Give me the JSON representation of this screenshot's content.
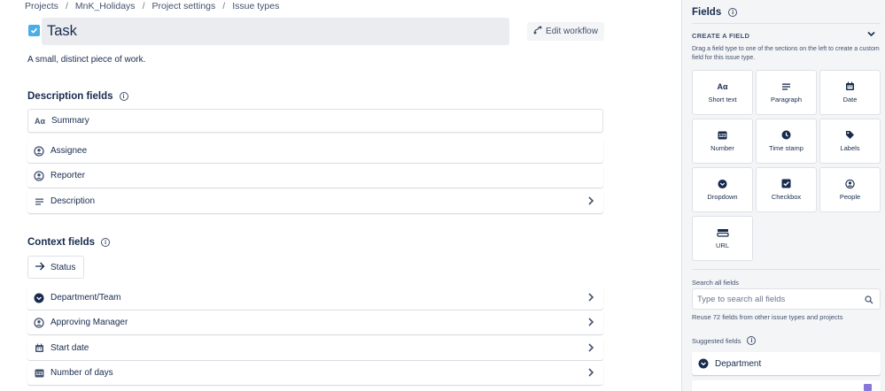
{
  "breadcrumbs": [
    "Projects",
    "MnK_Holidays",
    "Project settings",
    "Issue types"
  ],
  "issue_type": {
    "title": "Task",
    "description": "A small, distinct piece of work.",
    "edit_workflow_label": "Edit workflow"
  },
  "description_fields": {
    "title": "Description fields",
    "items": [
      {
        "label": "Summary",
        "icon": "text-icon"
      },
      {
        "label": "Assignee",
        "icon": "person-icon"
      },
      {
        "label": "Reporter",
        "icon": "person-icon"
      },
      {
        "label": "Description",
        "icon": "paragraph-icon"
      }
    ]
  },
  "context_fields": {
    "title": "Context fields",
    "status_label": "Status",
    "items": [
      {
        "label": "Department/Team",
        "icon": "dropdown-icon"
      },
      {
        "label": "Approving Manager",
        "icon": "person-icon"
      },
      {
        "label": "Start date",
        "icon": "calendar-icon"
      },
      {
        "label": "Number of days",
        "icon": "number-icon"
      }
    ]
  },
  "panel": {
    "title": "Fields",
    "create_header": "CREATE A FIELD",
    "create_help": "Drag a field type to one of the sections on the left to create a custom field for this issue type.",
    "field_types": [
      "Short text",
      "Paragraph",
      "Date",
      "Number",
      "Time stamp",
      "Labels",
      "Dropdown",
      "Checkbox",
      "People",
      "URL"
    ],
    "search_label": "Search all fields",
    "search_placeholder": "Type to search all fields",
    "search_value": "",
    "reuse_text": "Reuse 72 fields from other issue types and projects",
    "suggested_label": "Suggested fields",
    "suggested": [
      "Department"
    ]
  },
  "colors": {
    "accent": "#4bade8",
    "text": "#172b4d",
    "subtle": "#42526e",
    "panel_bg": "#f4f5f7",
    "border": "#dfe1e6"
  }
}
